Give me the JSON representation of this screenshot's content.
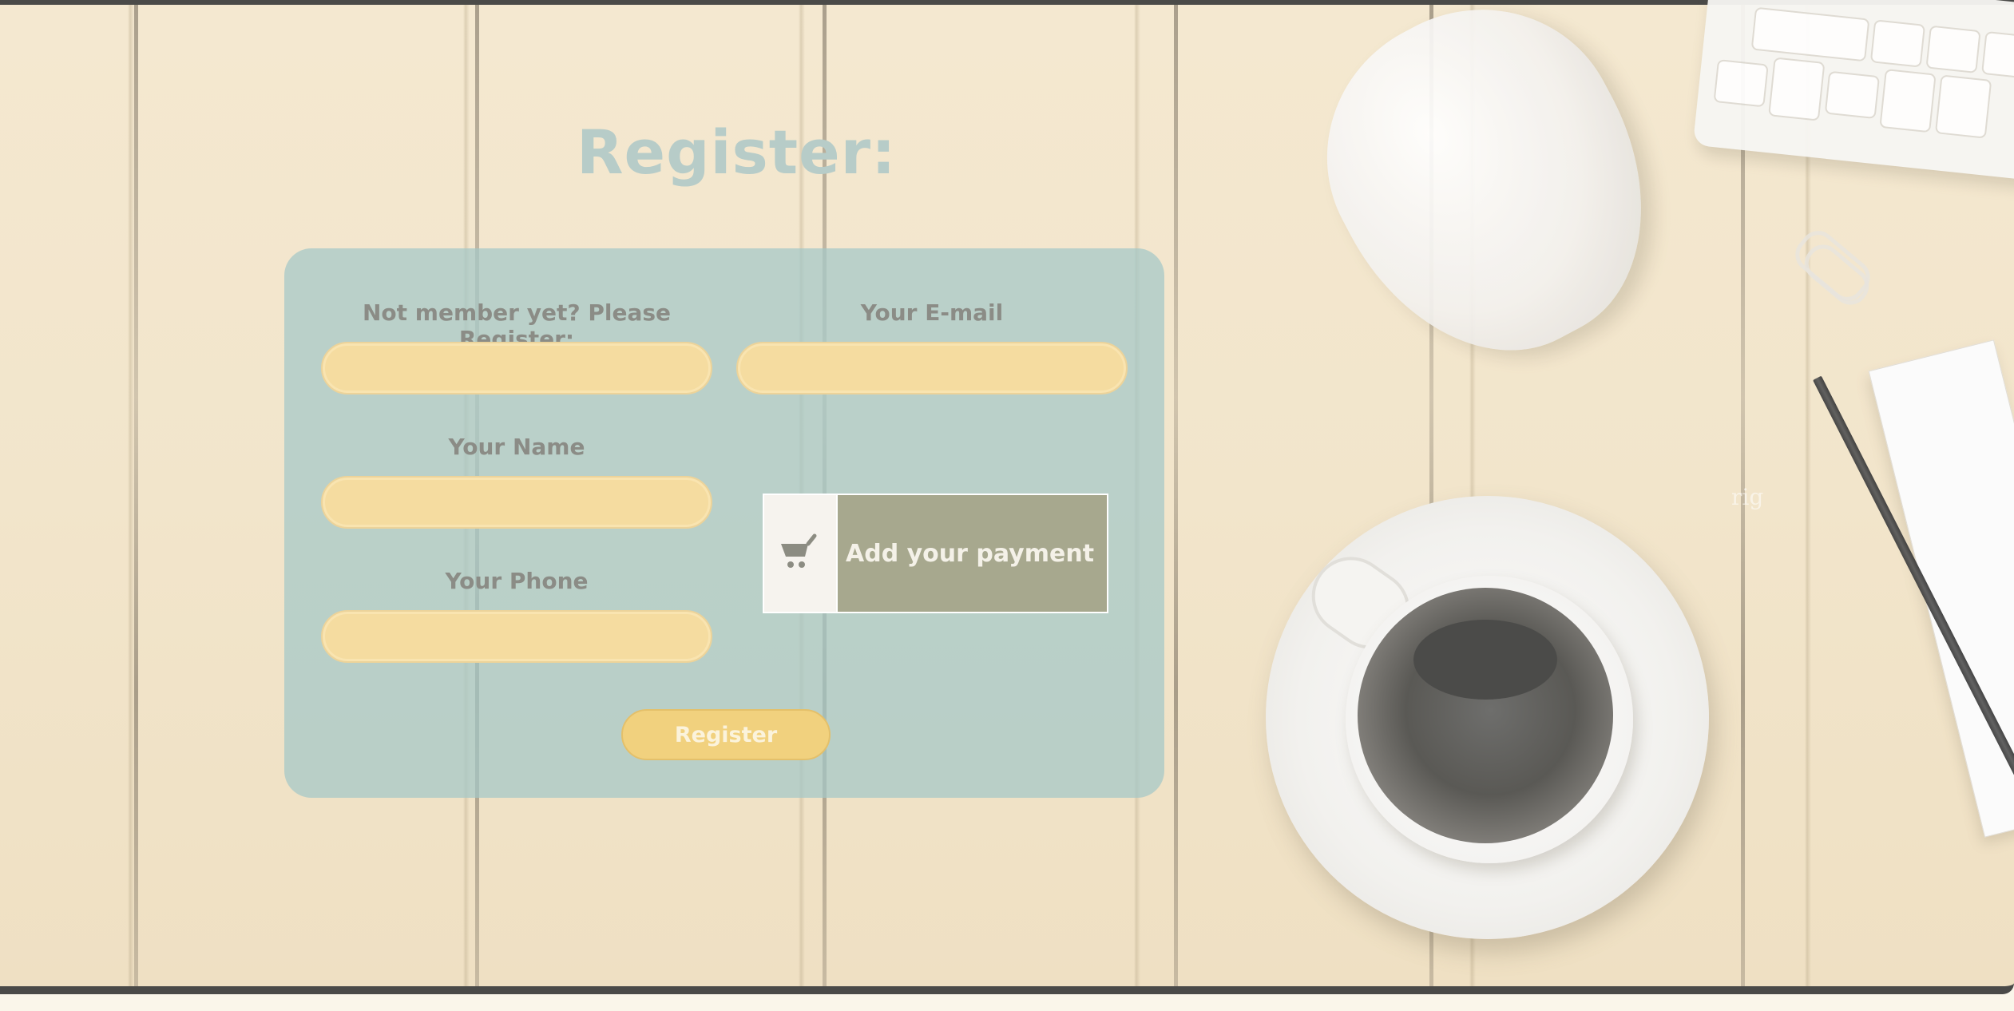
{
  "page": {
    "title": "Register:"
  },
  "form": {
    "section_label": "Not member yet? Please Register:",
    "email_label": "Your E-mail",
    "name_label": "Your Name",
    "phone_label": "Your Phone",
    "username_value": "",
    "email_value": "",
    "name_value": "",
    "phone_value": "",
    "submit_label": "Register"
  },
  "payment": {
    "label": "Add your payment",
    "icon": "shopping-cart-icon"
  },
  "background": {
    "faint_text": "rig"
  },
  "colors": {
    "card_bg": "#a4c7c7",
    "input_bg": "#f5dca0",
    "button_bg": "#f1d17e",
    "payment_bg": "#a7a88e",
    "title_color": "#b7ccc8"
  }
}
